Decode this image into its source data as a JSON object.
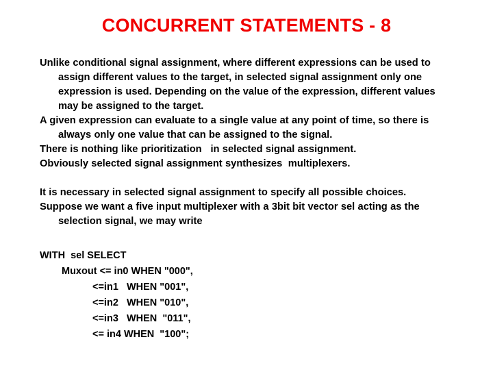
{
  "slide": {
    "title": "CONCURRENT STATEMENTS - 8",
    "title_color": "#f00000",
    "background_color": "#ffffff",
    "text_color": "#000000",
    "paragraphs": [
      {
        "id": "p1",
        "text": "Unlike conditional signal assignment, where different expressions can be used to assign different values to the target, in selected signal assignment only one expression is used. Depending on the value of the expression, different values may be assigned to the target."
      },
      {
        "id": "p2",
        "text": "A given expression can evaluate to a single value at any point of time, so there is always only one value that can be assigned to the signal."
      },
      {
        "id": "p3",
        "text": "There is nothing like prioritization   in selected signal assignment."
      },
      {
        "id": "p4",
        "text": "Obviously selected signal assignment synthesizes  multiplexers."
      },
      {
        "id": "p5",
        "text": "It is necessary in selected signal assignment to specify all possible choices."
      },
      {
        "id": "p6",
        "text": "Suppose we want a five input multiplexer with a 3bit bit vector sel acting as the selection signal, we may write"
      }
    ],
    "code": [
      {
        "id": "c1",
        "indent": 0,
        "text": "WITH  sel SELECT"
      },
      {
        "id": "c2",
        "indent": 1,
        "text": "Muxout <= in0 WHEN \"000\","
      },
      {
        "id": "c3",
        "indent": 2,
        "text": "<=in1   WHEN \"001\","
      },
      {
        "id": "c4",
        "indent": 2,
        "text": "<=in2   WHEN \"010\","
      },
      {
        "id": "c5",
        "indent": 2,
        "text": "<=in3   WHEN  \"011\","
      },
      {
        "id": "c6",
        "indent": 2,
        "text": "<= in4 WHEN  \"100\";"
      }
    ]
  }
}
